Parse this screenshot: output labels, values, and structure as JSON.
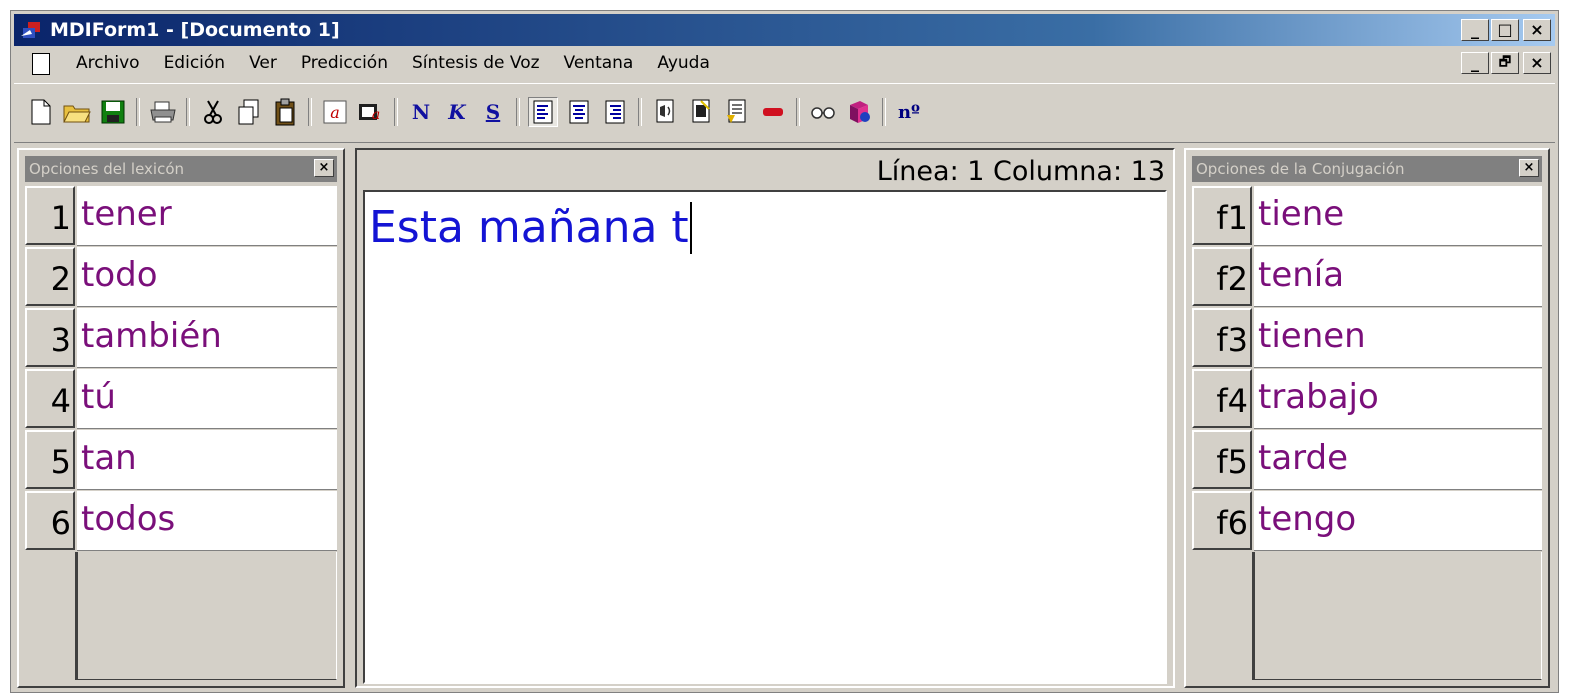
{
  "window": {
    "title": "MDIForm1 - [Documento 1]",
    "controls": [
      "_",
      "□",
      "×"
    ],
    "mdi_controls": [
      "_",
      "🗗",
      "×"
    ]
  },
  "menu": {
    "items": [
      "Archivo",
      "Edición",
      "Ver",
      "Predicción",
      "Síntesis de Voz",
      "Ventana",
      "Ayuda"
    ]
  },
  "toolbar": {
    "buttons": [
      "new-document-icon",
      "open-folder-icon",
      "save-icon",
      "print-icon",
      "cut-icon",
      "copy-icon",
      "paste-icon",
      "font-icon",
      "font-color-icon",
      "bold-icon",
      "italic-icon",
      "underline-icon",
      "align-left-icon",
      "align-center-icon",
      "align-right-icon",
      "speak-icon",
      "stop-icon",
      "read-icon",
      "eraser-icon",
      "glasses-icon",
      "dictionary-icon",
      "number-icon"
    ],
    "bold_label": "N",
    "italic_label": "K",
    "underline_label": "S",
    "number_label": "nº"
  },
  "lexicon": {
    "title": "Opciones del lexicón",
    "close": "×",
    "items": [
      {
        "key": "1",
        "word": "tener"
      },
      {
        "key": "2",
        "word": "todo"
      },
      {
        "key": "3",
        "word": "también"
      },
      {
        "key": "4",
        "word": "tú"
      },
      {
        "key": "5",
        "word": "tan"
      },
      {
        "key": "6",
        "word": "todos"
      }
    ]
  },
  "editor": {
    "status": "Línea: 1 Columna: 13",
    "text": "Esta mañana t"
  },
  "conjugation": {
    "title": "Opciones de la Conjugación",
    "close": "×",
    "items": [
      {
        "key": "f1",
        "word": "tiene"
      },
      {
        "key": "f2",
        "word": "tenía"
      },
      {
        "key": "f3",
        "word": "tienen"
      },
      {
        "key": "f4",
        "word": "trabajo"
      },
      {
        "key": "f5",
        "word": "tarde"
      },
      {
        "key": "f6",
        "word": "tengo"
      }
    ]
  },
  "colors": {
    "titlebar": "#0a246a",
    "face": "#d4d0c8",
    "word": "#7a0f7a",
    "editor_text": "#1414d4"
  }
}
